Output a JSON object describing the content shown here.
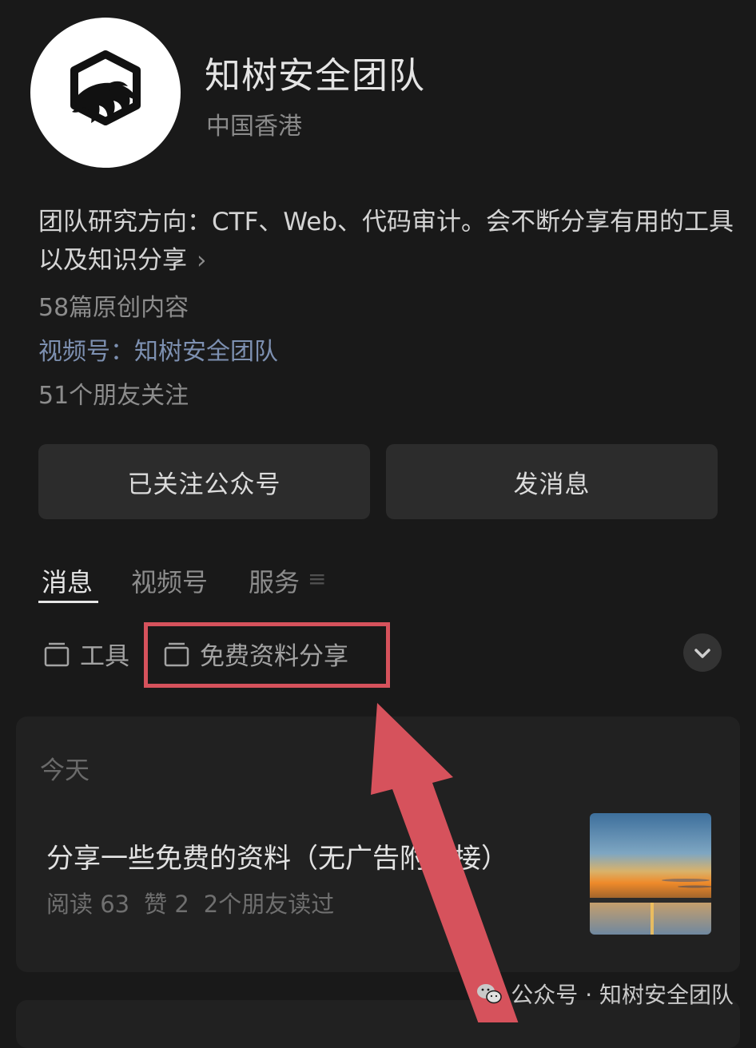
{
  "profile": {
    "name": "知树安全团队",
    "location": "中国香港",
    "intro": "团队研究方向：CTF、Web、代码审计。会不断分享有用的工具以及知识分享",
    "intro_chevron": "›",
    "original_count": "58篇原创内容",
    "channels_label": "视频号：",
    "channels_name": "知树安全团队",
    "friends_following": "51个朋友关注"
  },
  "buttons": {
    "follow": "已关注公众号",
    "message": "发消息"
  },
  "tabs": [
    {
      "label": "消息",
      "active": true
    },
    {
      "label": "视频号",
      "active": false
    },
    {
      "label": "服务",
      "active": false
    }
  ],
  "collections": [
    {
      "label": "工具",
      "icon": "collection-icon"
    },
    {
      "label": "免费资料分享",
      "icon": "collection-icon"
    }
  ],
  "feed": {
    "date_label": "今天",
    "article": {
      "title": "分享一些免费的资料（无广告附链接）",
      "reads": "阅读 63",
      "likes": "赞 2",
      "friends_read": "2个朋友读过",
      "thumbnail": "sunset-over-water"
    }
  },
  "watermark": {
    "text": "公众号 · 知树安全团队",
    "icon": "wechat-icon"
  },
  "colors": {
    "background": "#191919",
    "card": "#212121",
    "button": "#2c2c2c",
    "link": "#7d90b1",
    "annotation": "#d6525c"
  }
}
